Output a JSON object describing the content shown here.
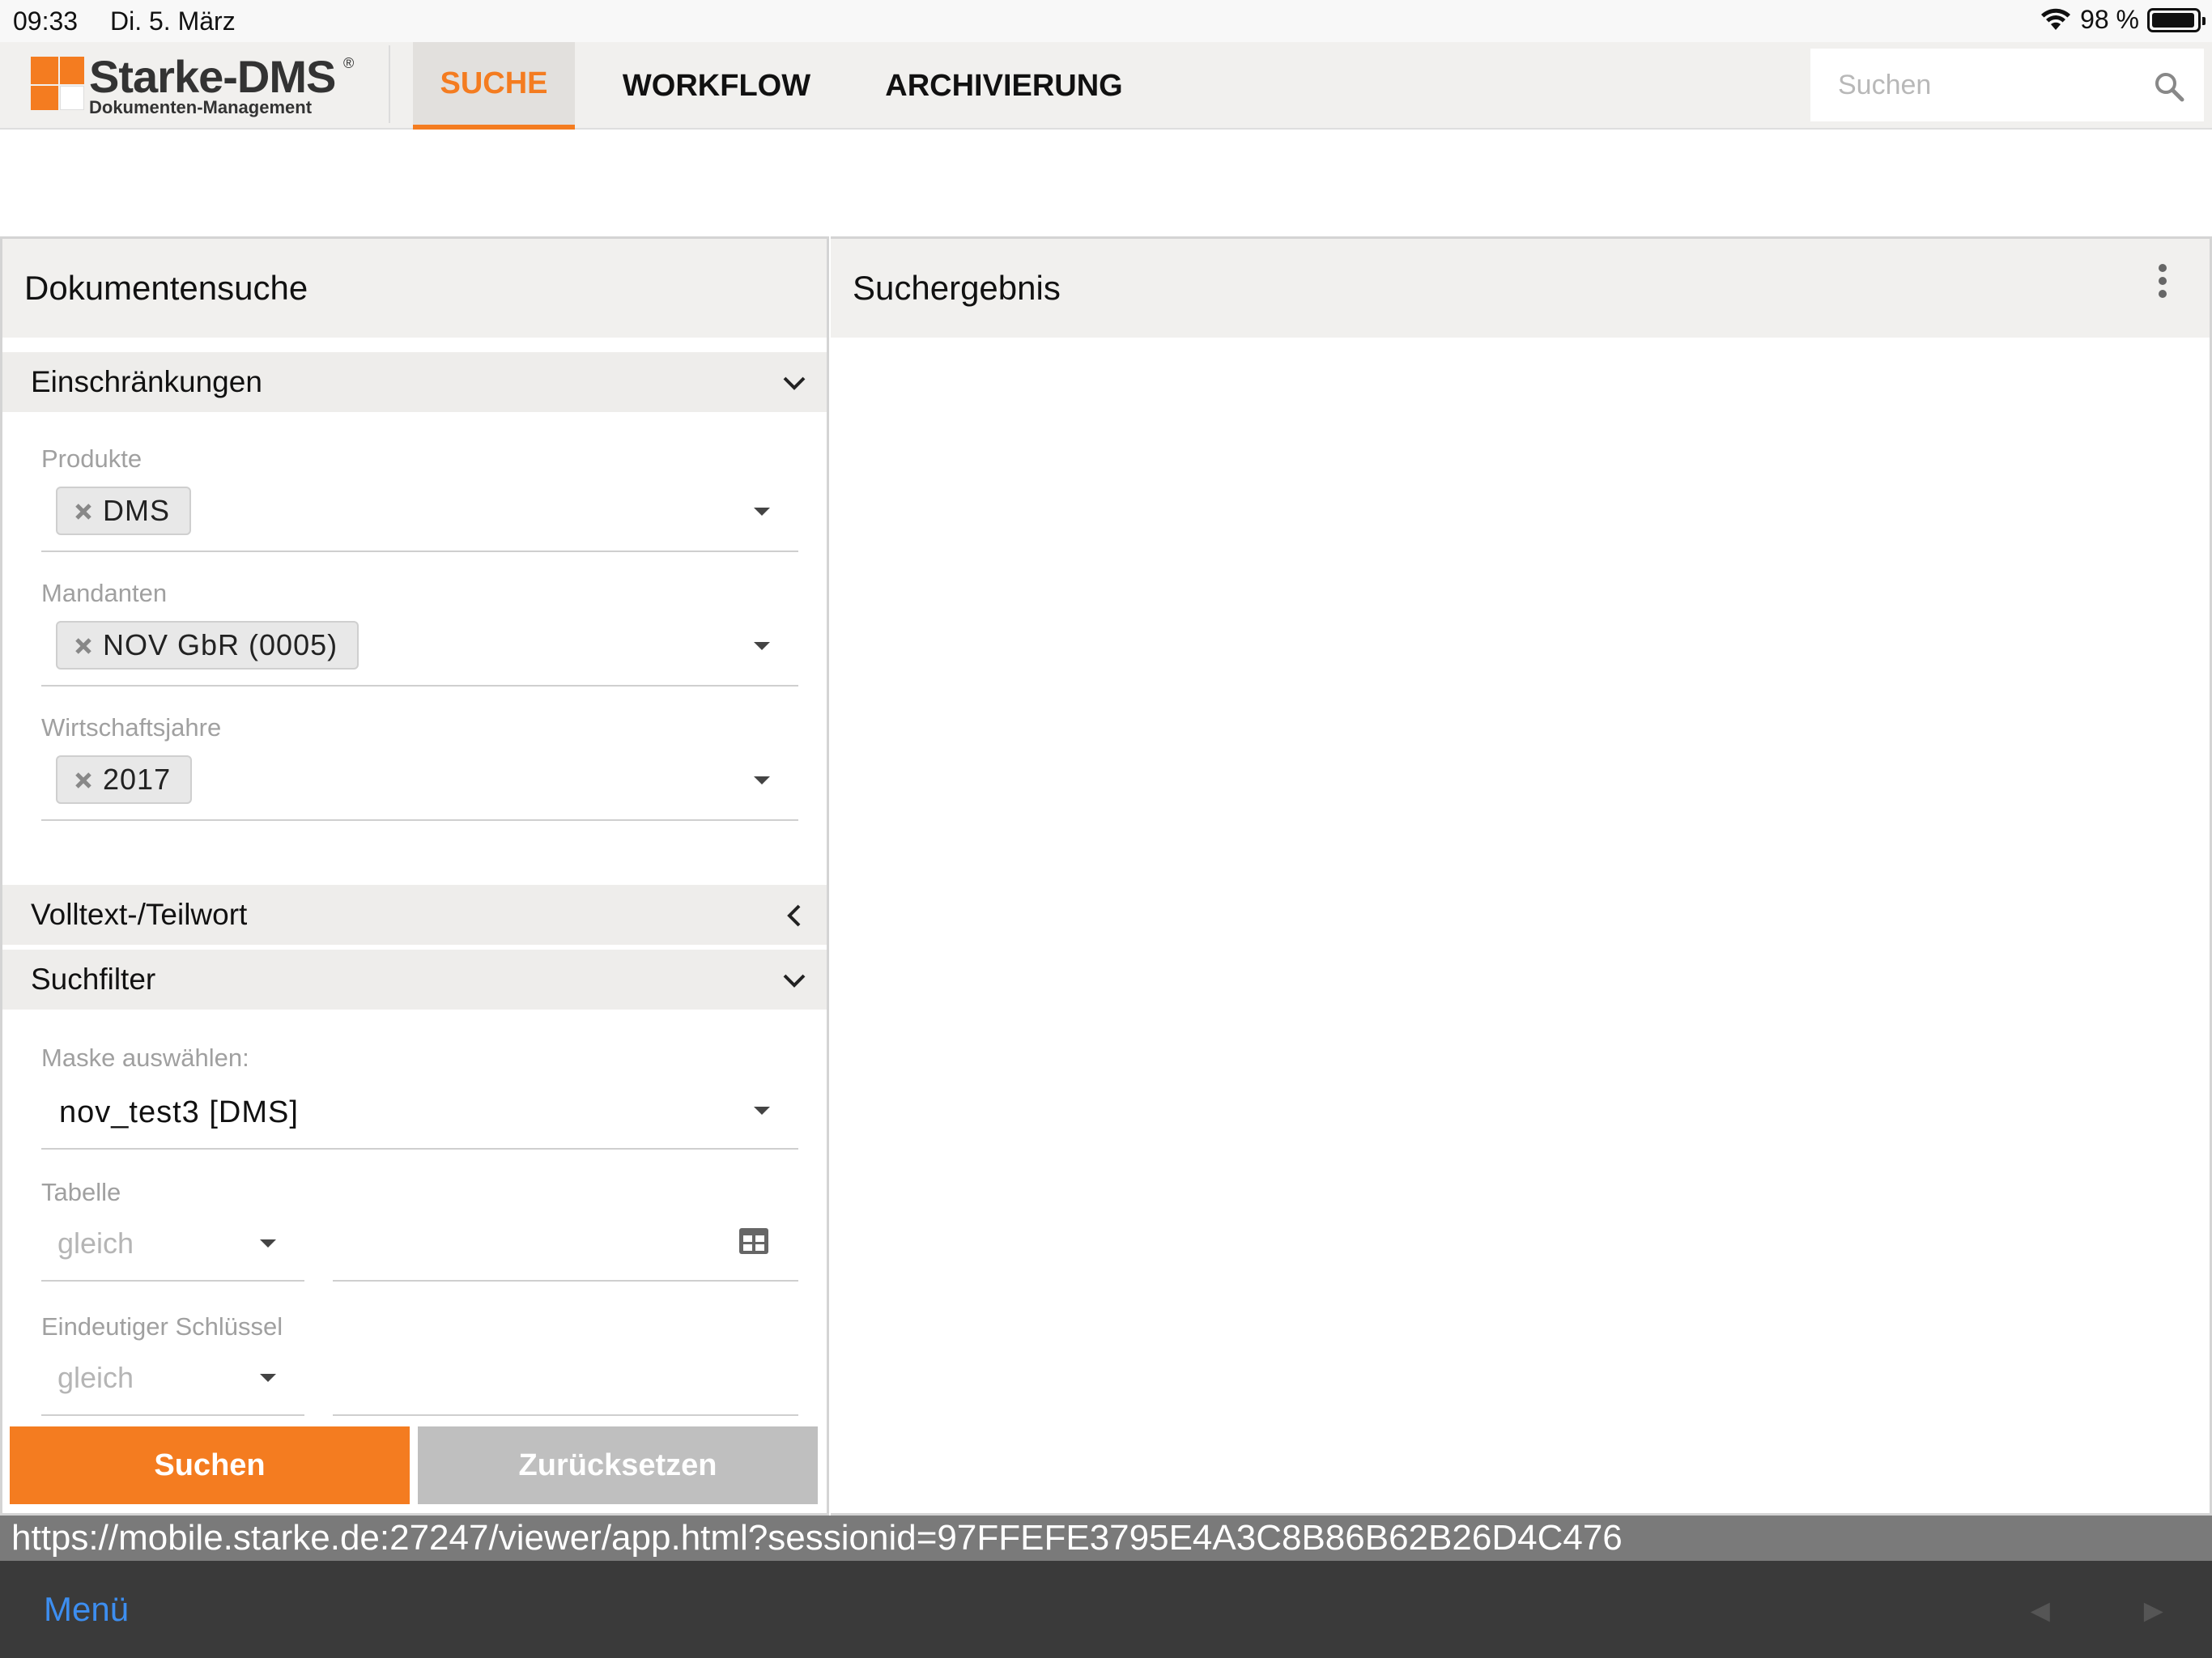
{
  "status": {
    "time": "09:33",
    "date": "Di. 5. März",
    "battery": "98 %",
    "battery_level": 0.98
  },
  "app": {
    "logo_name": "Starke-DMS",
    "logo_reg": "®",
    "logo_sub": "Dokumenten-Management",
    "tabs": [
      {
        "label": "SUCHE",
        "active": true
      },
      {
        "label": "WORKFLOW",
        "active": false
      },
      {
        "label": "ARCHIVIERUNG",
        "active": false
      }
    ],
    "search_placeholder": "Suchen"
  },
  "left": {
    "title": "Dokumentensuche",
    "einschraenkungen": {
      "label": "Einschränkungen",
      "fields": [
        {
          "label": "Produkte",
          "chip": "DMS"
        },
        {
          "label": "Mandanten",
          "chip": "NOV GbR (0005)"
        },
        {
          "label": "Wirtschaftsjahre",
          "chip": "2017"
        }
      ]
    },
    "volltext": {
      "label": "Volltext-/Teilwort"
    },
    "suchfilter": {
      "label": "Suchfilter",
      "maske_label": "Maske auswählen:",
      "maske_value": "nov_test3 [DMS]",
      "tabelle_label": "Tabelle",
      "tabelle_operator": "gleich",
      "schluessel_label": "Eindeutiger Schlüssel",
      "schluessel_operator": "gleich"
    },
    "buttons": {
      "search": "Suchen",
      "reset": "Zurücksetzen"
    }
  },
  "right": {
    "title": "Suchergebnis"
  },
  "url": "https://mobile.starke.de:27247/viewer/app.html?sessionid=97FFEFE3795E4A3C8B86B62B26D4C476",
  "bottom": {
    "menu": "Menü",
    "back": "◄",
    "forward": "►"
  },
  "colors": {
    "accent": "#f47c20",
    "link": "#3d8ef0",
    "panel_header": "#f1f0ee"
  }
}
